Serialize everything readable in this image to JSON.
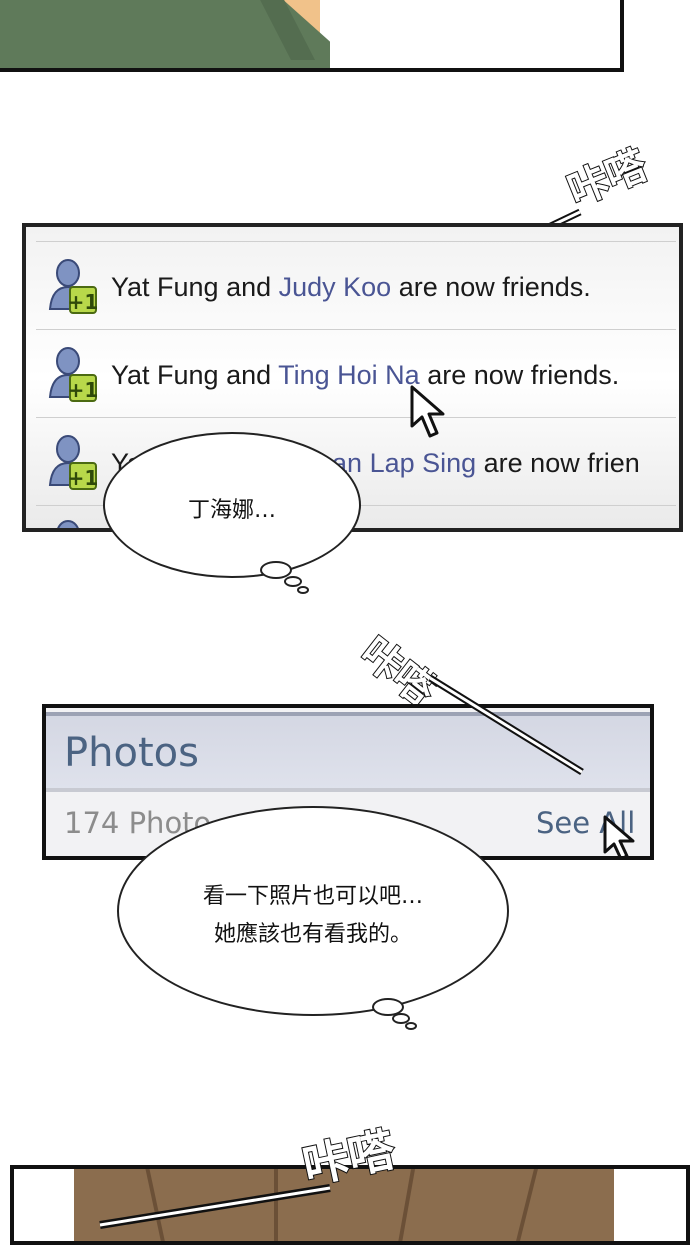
{
  "friends_feed": {
    "items": [
      {
        "prefix": "Yat Fung and ",
        "name": "Judy Koo",
        "suffix": " are now friends."
      },
      {
        "prefix": "Yat Fung and ",
        "name": "Ting Hoi Na",
        "suffix": " are now friends."
      },
      {
        "prefix": "Ya",
        "name": "an Lap Sing",
        "suffix": " are now frien"
      }
    ]
  },
  "photos_widget": {
    "title": "Photos",
    "count_label": "174 Photo",
    "see_all_label": "See All"
  },
  "sound_effects": [
    "咔嗒",
    "咔嗒",
    "咔嗒"
  ],
  "thought_bubbles": [
    {
      "lines": [
        "丁海娜…"
      ]
    },
    {
      "lines": [
        "看一下照片也可以吧…",
        "她應該也有看我的。"
      ]
    }
  ],
  "colors": {
    "link_name": "#4a5594",
    "photos_title": "#4b6382"
  },
  "icons": [
    "friend-add-icon",
    "mouse-cursor-icon"
  ]
}
